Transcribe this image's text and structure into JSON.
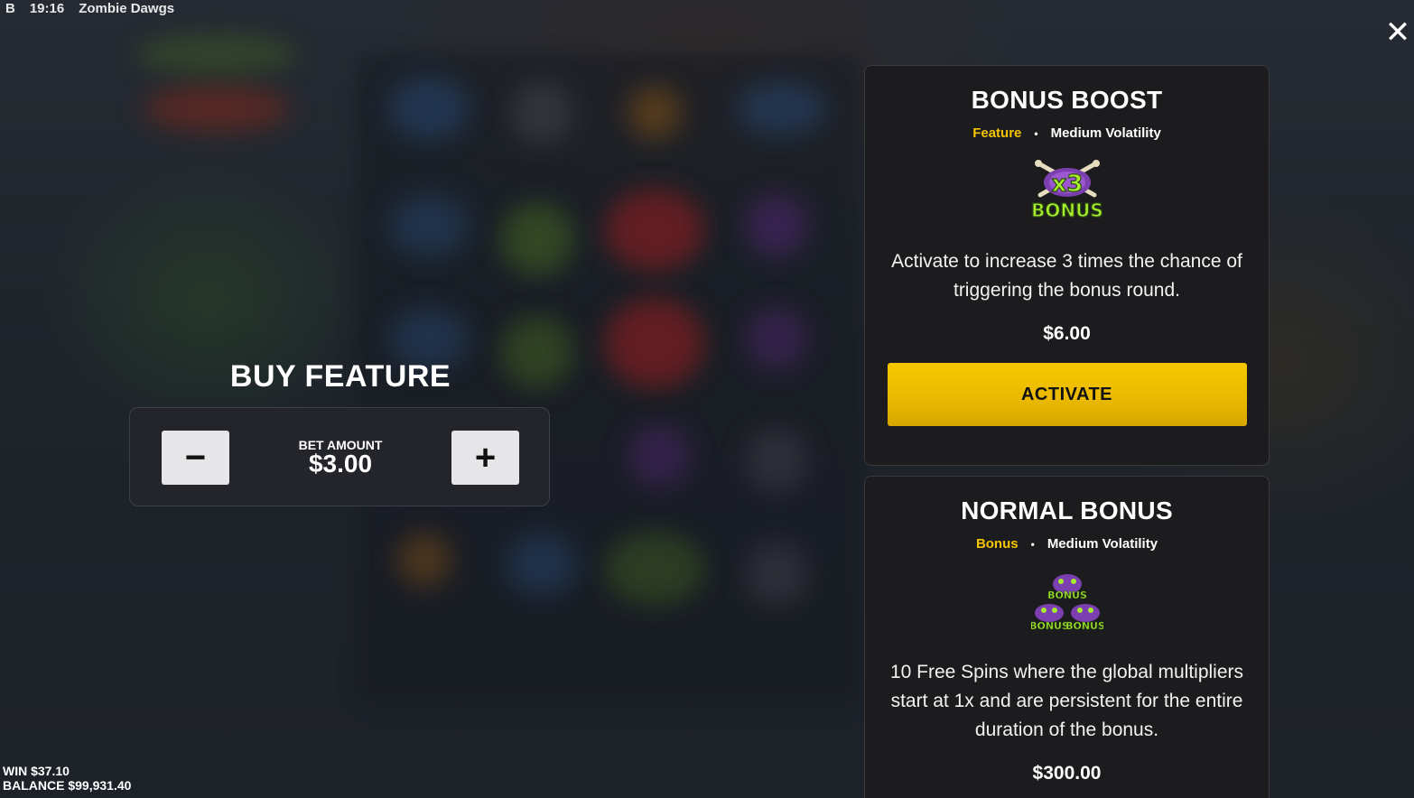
{
  "status_bar": {
    "badge": "B",
    "time": "19:16",
    "game_title": "Zombie Dawgs"
  },
  "close_glyph": "✕",
  "buy_feature": {
    "title": "BUY FEATURE",
    "bet_label": "BET AMOUNT",
    "bet_value": "$3.00",
    "minus_glyph": "−",
    "plus_glyph": "+"
  },
  "cards": [
    {
      "title": "BONUS BOOST",
      "type": "Feature",
      "dot": "•",
      "volatility": "Medium Volatility",
      "icon": "x3-bonus-icon",
      "description": "Activate to increase 3 times the chance of triggering the bonus round.",
      "price": "$6.00",
      "button_label": "ACTIVATE"
    },
    {
      "title": "NORMAL BONUS",
      "type": "Bonus",
      "dot": "•",
      "volatility": "Medium Volatility",
      "icon": "bonus-stack-icon",
      "description": "10 Free Spins where the global multipliers start at 1x and are persistent for the entire duration of the bonus.",
      "price": "$300.00"
    }
  ],
  "footer": {
    "win_label": "WIN",
    "win_value": "$37.10",
    "balance_label": "BALANCE",
    "balance_value": "$99,931.40"
  },
  "icon_art": {
    "x3_text": "x3",
    "bonus_text": "BONUS"
  },
  "colors": {
    "accent_yellow": "#f5c400",
    "button_yellow": "#f7c800",
    "card_bg": "#1c1c1e",
    "bonus_green": "#9be22a",
    "bonus_purple": "#7b3fb0"
  }
}
